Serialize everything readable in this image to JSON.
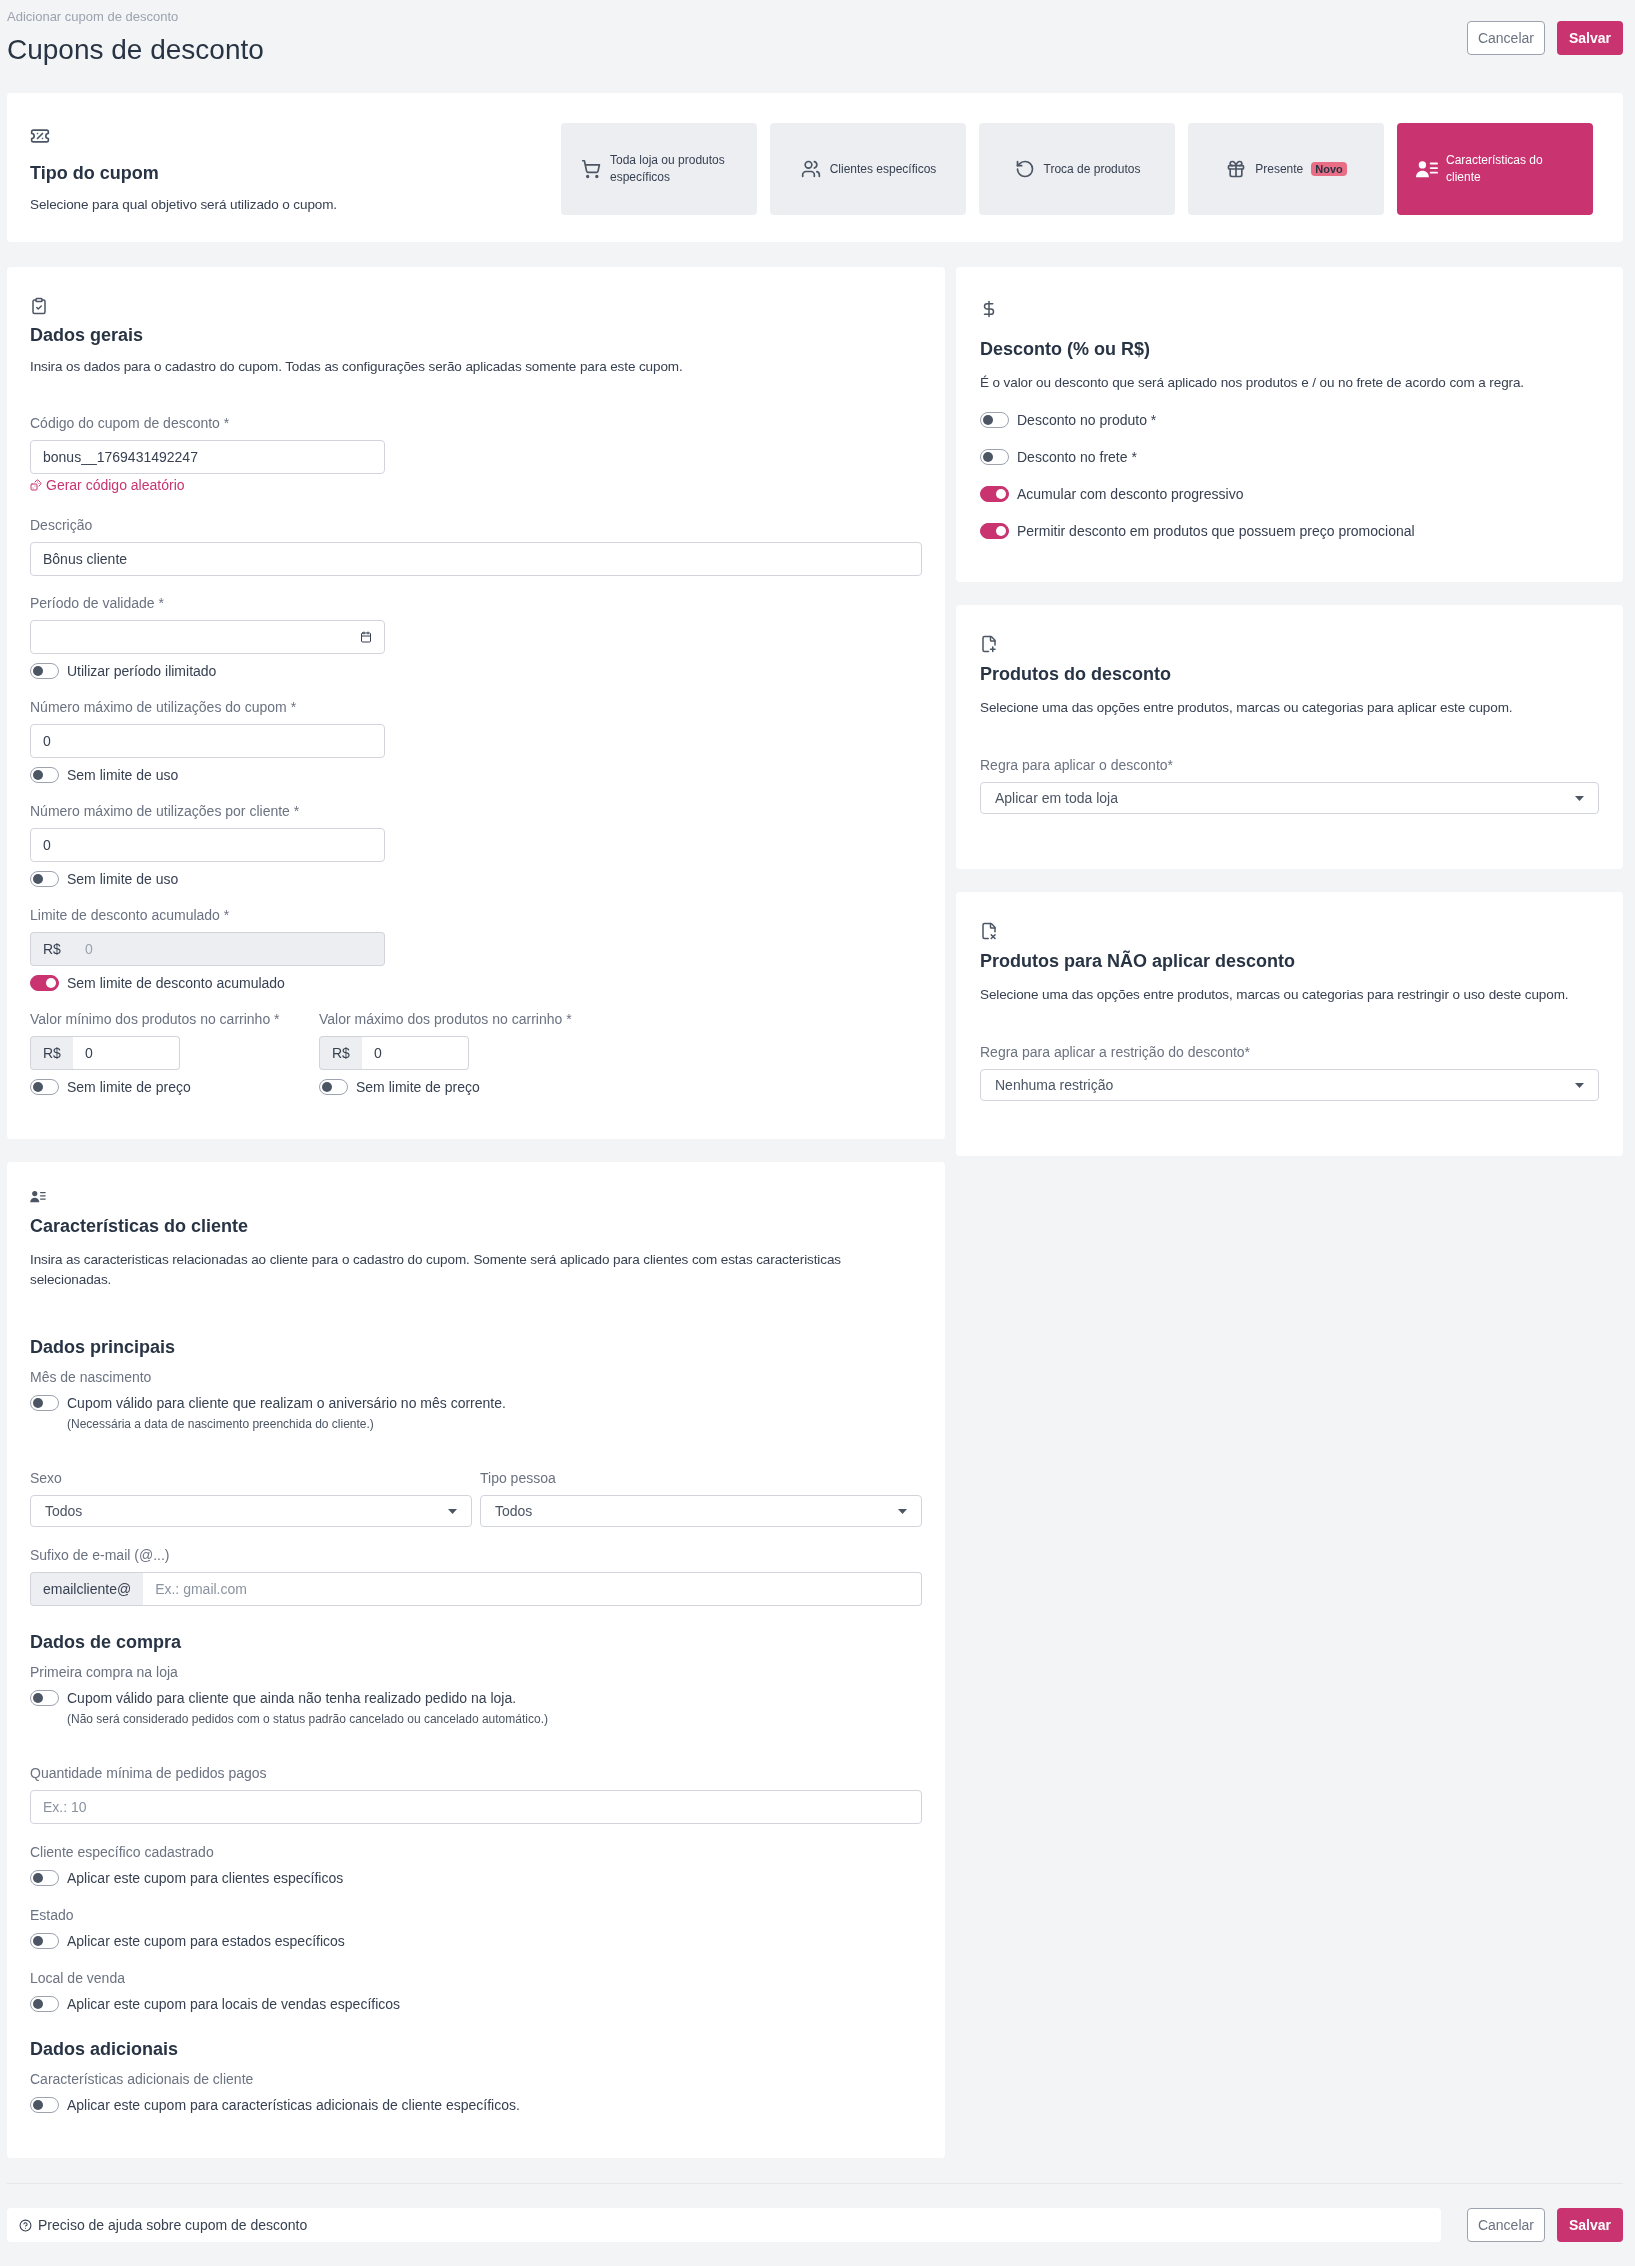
{
  "header": {
    "breadcrumb": "Adicionar cupom de desconto",
    "title": "Cupons de desconto",
    "buttons": [
      {
        "label": "Cancelar",
        "kind": "secondary"
      },
      {
        "label": "Salvar",
        "kind": "primary"
      }
    ]
  },
  "coupon_type": {
    "title": "Tipo do cupom",
    "description": "Selecione para qual objetivo será utilizado o cupom.",
    "options": [
      {
        "label": "Toda loja ou produtos específicos",
        "selected": false
      },
      {
        "label": "Clientes específicos",
        "selected": false
      },
      {
        "label": "Troca de produtos",
        "selected": false
      },
      {
        "label": "Presente",
        "badge": "Novo",
        "selected": false
      },
      {
        "label": "Características do cliente",
        "selected": true
      }
    ]
  },
  "general": {
    "title": "Dados gerais",
    "description": "Insira os dados para o cadastro do cupom. Todas as configurações serão aplicadas somente para este cupom.",
    "code": {
      "label": "Código do cupom de desconto *",
      "value": "bonus__1769431492247",
      "link": "Gerar código aleatório"
    },
    "coupon_description": {
      "label": "Descrição",
      "value": "Bônus cliente"
    },
    "validity": {
      "label": "Período de validade *",
      "toggle": {
        "label": "Utilizar período ilimitado",
        "on": false
      }
    },
    "max_uses": {
      "label": "Número máximo de utilizações do cupom *",
      "value": "0",
      "toggle": {
        "label": "Sem limite de uso",
        "on": false
      }
    },
    "max_uses_per_client": {
      "label": "Número máximo de utilizações por cliente *",
      "value": "0",
      "toggle": {
        "label": "Sem limite de uso",
        "on": false
      }
    },
    "accumulated_limit": {
      "label": "Limite de desconto acumulado *",
      "prefix": "R$",
      "value": "0",
      "disabled": true,
      "toggle": {
        "label": "Sem limite de desconto acumulado",
        "on": true
      }
    },
    "cart_limits": [
      {
        "label": "Valor mínimo dos produtos no carrinho *",
        "prefix": "R$",
        "value": "0",
        "disabled": false,
        "toggle": {
          "label": "Sem limite de preço",
          "on": false
        }
      },
      {
        "label": "Valor máximo dos produtos no carrinho *",
        "prefix": "R$",
        "value": "0",
        "disabled": false,
        "toggle": {
          "label": "Sem limite de preço",
          "on": false
        }
      }
    ]
  },
  "discount": {
    "title": "Desconto (% ou R$)",
    "description": "É o valor ou desconto que será aplicado nos produtos e / ou no frete de acordo com a regra.",
    "toggles": [
      {
        "label": "Desconto no produto *",
        "on": false
      },
      {
        "label": "Desconto no frete *",
        "on": false
      },
      {
        "label": "Acumular com desconto progressivo",
        "on": true
      },
      {
        "label": "Permitir desconto em produtos que possuem preço promocional",
        "on": true
      }
    ]
  },
  "products": {
    "title": "Produtos do desconto",
    "description": "Selecione uma das opções entre produtos, marcas ou categorias para aplicar este cupom.",
    "select": {
      "label": "Regra para aplicar o desconto*",
      "value": "Aplicar em toda loja"
    }
  },
  "excluded_products": {
    "title": "Produtos para NÃO aplicar desconto",
    "description": "Selecione uma das opções entre produtos, marcas ou categorias para restringir o uso deste cupom.",
    "select": {
      "label": "Regra para aplicar a restrição do desconto*",
      "value": "Nenhuma restrição"
    }
  },
  "client": {
    "title": "Características do cliente",
    "description": "Insira as caracteristicas relacionadas ao cliente para o cadastro do cupom. Somente será aplicado para clientes com estas caracteristicas selecionadas.",
    "sections": [
      {
        "title": "Dados principais",
        "items": [
          {
            "kind": "toggle",
            "label": "Mês de nascimento",
            "toggle_label": "Cupom válido para cliente que realizam o aniversário no mês corrente.",
            "on": false,
            "note": "(Necessária a data de nascimento preenchida do cliente.)"
          },
          {
            "kind": "select_pair",
            "selects": [
              {
                "label": "Sexo",
                "value": "Todos"
              },
              {
                "label": "Tipo pessoa",
                "value": "Todos"
              }
            ]
          },
          {
            "kind": "prefixed_input",
            "label": "Sufixo de e-mail (@...)",
            "prefix": "emailcliente@",
            "placeholder": "Ex.: gmail.com"
          }
        ]
      },
      {
        "title": "Dados de compra",
        "items": [
          {
            "kind": "toggle",
            "label": "Primeira compra na loja",
            "toggle_label": "Cupom válido para cliente que ainda não tenha realizado pedido na loja.",
            "on": false,
            "note": "(Não será considerado pedidos com o status padrão cancelado ou cancelado automático.)"
          },
          {
            "kind": "input",
            "label": "Quantidade mínima de pedidos pagos",
            "placeholder": "Ex.: 10"
          },
          {
            "kind": "toggle",
            "label": "Cliente específico cadastrado",
            "toggle_label": "Aplicar este cupom para clientes específicos",
            "on": false
          },
          {
            "kind": "toggle",
            "label": "Estado",
            "toggle_label": "Aplicar este cupom para estados específicos",
            "on": false
          },
          {
            "kind": "toggle",
            "label": "Local de venda",
            "toggle_label": "Aplicar este cupom para locais de vendas específicos",
            "on": false
          }
        ]
      },
      {
        "title": "Dados adicionais",
        "items": [
          {
            "kind": "toggle",
            "label": "Características adicionais de cliente",
            "toggle_label": "Aplicar este cupom para características adicionais de cliente específicos.",
            "on": false
          }
        ]
      }
    ]
  },
  "footer": {
    "help": "Preciso de ajuda sobre cupom de desconto",
    "buttons": [
      {
        "label": "Cancelar",
        "kind": "secondary"
      },
      {
        "label": "Salvar",
        "kind": "primary"
      }
    ]
  }
}
